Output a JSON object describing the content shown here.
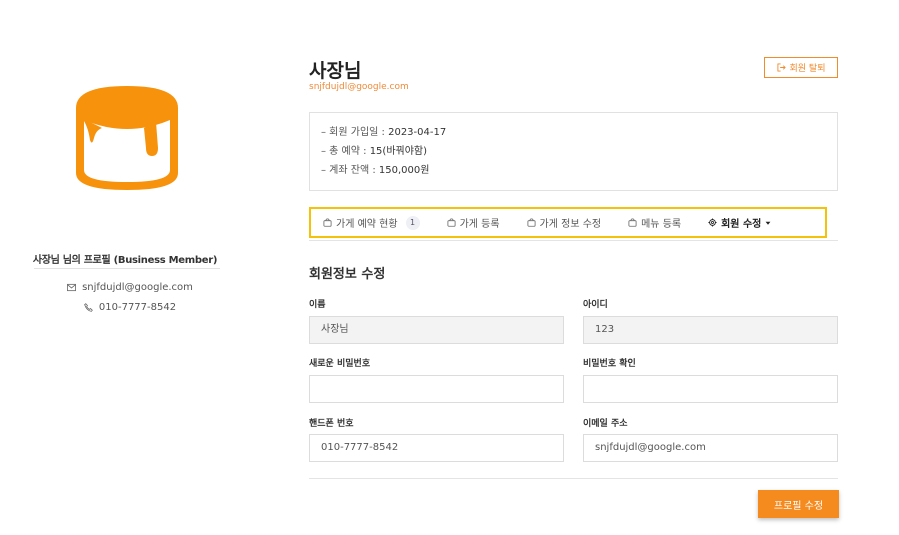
{
  "colors": {
    "accent": "#f58a1f",
    "highlight": "#f4c10b"
  },
  "sidebar": {
    "profile_title": "사장님 님의 프로필 (Business Member)",
    "email": "snjfdujdl@google.com",
    "phone": "010-7777-8542",
    "logo_icon": "pudding-icon"
  },
  "header": {
    "name": "사장님",
    "email": "snjfdujdl@google.com",
    "withdraw_label": "회원 탈퇴"
  },
  "info": {
    "joined": "– 회원 가입일 : ",
    "joined_value": "2023-04-17",
    "reservations": "– 총 예약 : ",
    "reservations_value": "15(바꿔야함)",
    "balance": "– 계좌 잔액 : ",
    "balance_value": "150,000원"
  },
  "tabs": [
    {
      "label": "가게 예약 현황",
      "badge": "1"
    },
    {
      "label": "가게 등록"
    },
    {
      "label": "가게 정보 수정"
    },
    {
      "label": "메뉴 등록"
    },
    {
      "label": "회원 수정"
    }
  ],
  "form": {
    "title": "회원정보 수정",
    "name_label": "이름",
    "name_value": "사장님",
    "id_label": "아이디",
    "id_value": "123",
    "new_pw_label": "새로운 비밀번호",
    "new_pw_value": "",
    "confirm_pw_label": "비밀번호 확인",
    "confirm_pw_value": "",
    "phone_label": "핸드폰 번호",
    "phone_value": "010-7777-8542",
    "email_label": "이메일 주소",
    "email_value": "snjfdujdl@google.com",
    "submit_label": "프로필 수정"
  }
}
